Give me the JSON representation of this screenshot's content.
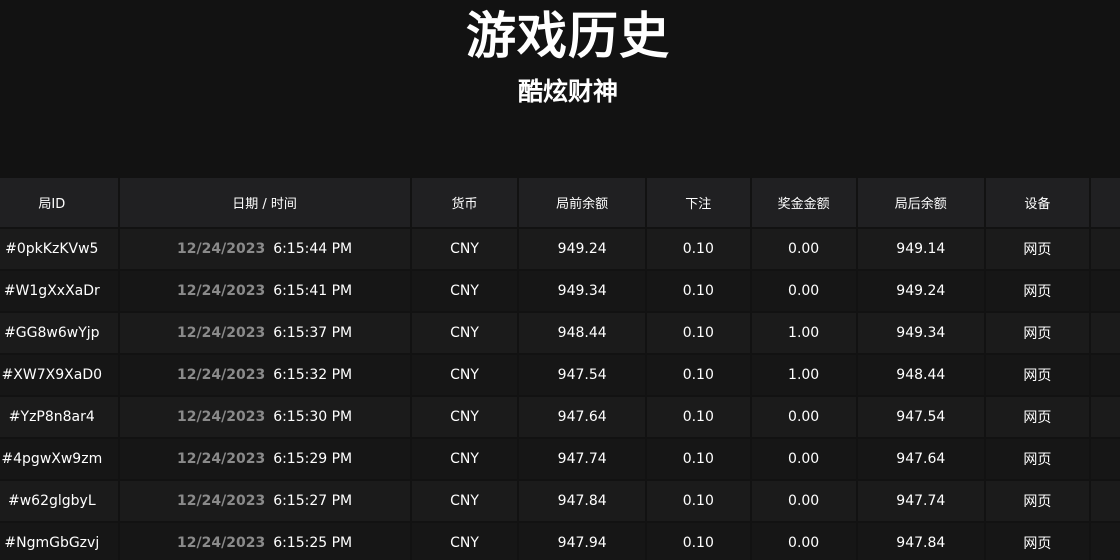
{
  "header": {
    "title": "游戏历史",
    "subtitle": "酷炫财神"
  },
  "table": {
    "columns": [
      "局ID",
      "日期 / 时间",
      "货币",
      "局前余额",
      "下注",
      "奖金金额",
      "局后余额",
      "设备",
      ""
    ],
    "rows": [
      {
        "id": "#0pkKzKVw5",
        "date": "12/24/2023",
        "time": "6:15:44 PM",
        "currency": "CNY",
        "before": "949.24",
        "bet": "0.10",
        "win": "0.00",
        "after": "949.14",
        "device": "网页"
      },
      {
        "id": "#W1gXxXaDr",
        "date": "12/24/2023",
        "time": "6:15:41 PM",
        "currency": "CNY",
        "before": "949.34",
        "bet": "0.10",
        "win": "0.00",
        "after": "949.24",
        "device": "网页"
      },
      {
        "id": "#GG8w6wYjp",
        "date": "12/24/2023",
        "time": "6:15:37 PM",
        "currency": "CNY",
        "before": "948.44",
        "bet": "0.10",
        "win": "1.00",
        "after": "949.34",
        "device": "网页"
      },
      {
        "id": "#XW7X9XaD0",
        "date": "12/24/2023",
        "time": "6:15:32 PM",
        "currency": "CNY",
        "before": "947.54",
        "bet": "0.10",
        "win": "1.00",
        "after": "948.44",
        "device": "网页"
      },
      {
        "id": "#YzP8n8ar4",
        "date": "12/24/2023",
        "time": "6:15:30 PM",
        "currency": "CNY",
        "before": "947.64",
        "bet": "0.10",
        "win": "0.00",
        "after": "947.54",
        "device": "网页"
      },
      {
        "id": "#4pgwXw9zm",
        "date": "12/24/2023",
        "time": "6:15:29 PM",
        "currency": "CNY",
        "before": "947.74",
        "bet": "0.10",
        "win": "0.00",
        "after": "947.64",
        "device": "网页"
      },
      {
        "id": "#w62glgbyL",
        "date": "12/24/2023",
        "time": "6:15:27 PM",
        "currency": "CNY",
        "before": "947.84",
        "bet": "0.10",
        "win": "0.00",
        "after": "947.74",
        "device": "网页"
      },
      {
        "id": "#NgmGbGzvj",
        "date": "12/24/2023",
        "time": "6:15:25 PM",
        "currency": "CNY",
        "before": "947.94",
        "bet": "0.10",
        "win": "0.00",
        "after": "947.84",
        "device": "网页"
      }
    ]
  }
}
